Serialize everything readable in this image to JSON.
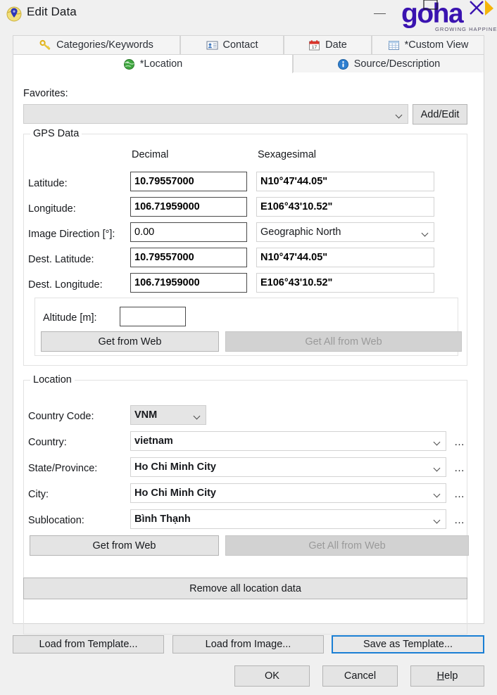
{
  "window": {
    "title": "Edit Data",
    "icon": "globe-pin-icon",
    "minimize_label": "Minimize",
    "logo_text": "goha",
    "logo_tagline": "GROWING HAPPINESS",
    "logo_color": "#3a13b0",
    "logo_accent": "#f5b50a"
  },
  "tabs_row1": [
    {
      "label": "Categories/Keywords",
      "icon": "key-icon",
      "active": false
    },
    {
      "label": "Contact",
      "icon": "contact-card-icon",
      "active": false
    },
    {
      "label": "Date",
      "icon": "calendar-icon",
      "active": false
    },
    {
      "label": "*Custom View",
      "icon": "table-icon",
      "active": false
    }
  ],
  "tabs_row2": [
    {
      "label": "*Location",
      "icon": "globe-icon",
      "active": true
    },
    {
      "label": "Source/Description",
      "icon": "info-icon",
      "active": false
    }
  ],
  "favorites": {
    "label": "Favorites:",
    "value": "",
    "add_edit_label": "Add/Edit"
  },
  "gps": {
    "group_title": "GPS Data",
    "col_decimal": "Decimal",
    "col_sexagesimal": "Sexagesimal",
    "rows": [
      {
        "label": "Latitude:",
        "decimal": "10.79557000",
        "sexagesimal": "N10°47'44.05\""
      },
      {
        "label": "Longitude:",
        "decimal": "106.71959000",
        "sexagesimal": "E106°43'10.52\""
      },
      {
        "label": "Dest. Latitude:",
        "decimal": "10.79557000",
        "sexagesimal": "N10°47'44.05\""
      },
      {
        "label": "Dest. Longitude:",
        "decimal": "106.71959000",
        "sexagesimal": "E106°43'10.52\""
      }
    ],
    "image_direction": {
      "label": "Image Direction [°]:",
      "value": "0.00",
      "reference": "Geographic North"
    },
    "altitude": {
      "label": "Altitude [m]:",
      "value": ""
    },
    "get_from_web": "Get from Web",
    "get_all_from_web": "Get All from Web"
  },
  "location": {
    "group_title": "Location",
    "country_code": {
      "label": "Country Code:",
      "value": "VNM"
    },
    "fields": [
      {
        "label": "Country:",
        "value": "vietnam",
        "more": "…"
      },
      {
        "label": "State/Province:",
        "value": "Ho Chi Minh City",
        "more": "…"
      },
      {
        "label": "City:",
        "value": "Ho Chi Minh City",
        "more": "…"
      },
      {
        "label": "Sublocation:",
        "value": "Bình Thạnh",
        "more": "…"
      }
    ],
    "get_from_web": "Get from Web",
    "get_all_from_web": "Get All from Web",
    "remove_all": "Remove all location data"
  },
  "footer": {
    "load_from_template": "Load from Template...",
    "load_from_image": "Load from Image...",
    "save_as_template": "Save as Template...",
    "ok": "OK",
    "cancel": "Cancel",
    "help_prefix": "H",
    "help_rest": "elp"
  }
}
